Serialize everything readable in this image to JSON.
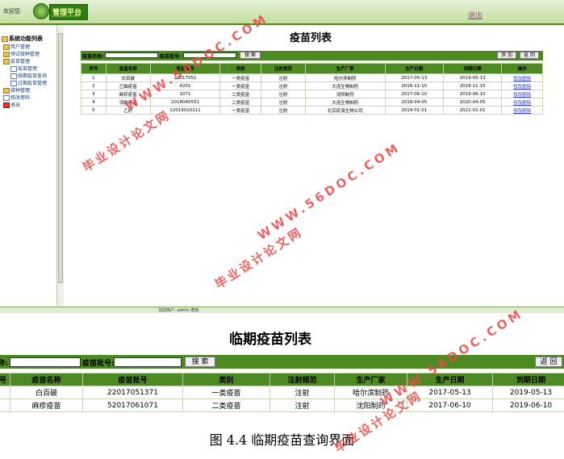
{
  "header": {
    "welcome": "欢迎您·",
    "logo_text": "管理平台",
    "logo_sub": "SUPREME SYSTEM",
    "logout": "退出"
  },
  "sidebar": {
    "root": "系统功能列表",
    "items": [
      {
        "label": "用户管理",
        "icon": "folder-icon"
      },
      {
        "label": "预试接种管理",
        "icon": "folder-icon"
      },
      {
        "label": "疫苗管理",
        "icon": "folder-icon"
      },
      {
        "label": "疫苗管理",
        "icon": "document-icon"
      },
      {
        "label": "临期疫苗查询",
        "icon": "document-icon"
      },
      {
        "label": "过期疫苗管理",
        "icon": "document-icon"
      },
      {
        "label": "接种管理",
        "icon": "folder-icon"
      },
      {
        "label": "修改密码",
        "icon": "key-icon"
      },
      {
        "label": "退出",
        "icon": "exit-icon"
      }
    ]
  },
  "status": {
    "text": "当前用户: admin  角色"
  },
  "list1": {
    "title": "疫苗列表",
    "search_name_label": "疫苗名称:",
    "search_batch_label": "疫苗批号:",
    "search_button": "搜 索",
    "add_button": "添 加",
    "back_button": "返 回",
    "headers": [
      "序号",
      "疫苗名称",
      "疫苗批号",
      "类别",
      "注射规范",
      "生产厂家",
      "生产日期",
      "到期日期",
      "操作"
    ],
    "rows": [
      [
        "1",
        "白百破",
        "22017051",
        "一类疫苗",
        "注射",
        "哈尔滨制药",
        "2017-05-13",
        "2019-05-13"
      ],
      [
        "2",
        "乙脑疫苗",
        "4201",
        "一类疫苗",
        "注射",
        "大连生物制药",
        "2016-11-15",
        "2018-11-15"
      ],
      [
        "3",
        "麻疹疫苗",
        "1071",
        "二类疫苗",
        "注射",
        "沈阳制药",
        "2017-06-10",
        "2019-06-10"
      ],
      [
        "4",
        "流脑疫苗",
        "2018040551",
        "二类疫苗",
        "注射",
        "大连生物制药",
        "2018-04-05",
        "2020-04-05"
      ],
      [
        "5",
        "乙肝",
        "12019010111",
        "一类疫苗",
        "注射",
        "北京民海生物公司",
        "2019-01-01",
        "2021-01-01"
      ]
    ],
    "op_edit": "修改",
    "op_delete": "删除"
  },
  "list2": {
    "title": "临期疫苗列表",
    "search_name_label": "名称:",
    "search_batch_label": "疫苗批号:",
    "search_button": "搜 索",
    "back_button": "返 回",
    "headers": [
      "号",
      "疫苗名称",
      "疫苗批号",
      "类别",
      "注射规范",
      "生产厂家",
      "生产日期",
      "到期日期"
    ],
    "rows": [
      [
        "",
        "白百破",
        "22017051371",
        "一类疫苗",
        "注射",
        "哈尔滨制药",
        "2017-05-13",
        "2019-05-13"
      ],
      [
        "",
        "麻疹疫苗",
        "52017061071",
        "二类疫苗",
        "注射",
        "沈阳制药",
        "2017-06-10",
        "2019-06-10"
      ]
    ]
  },
  "caption": "图 4.4 临期疫苗查询界面",
  "watermark": {
    "url": "WWW.56DOC.COM",
    "cn": "毕业设计论文网"
  }
}
